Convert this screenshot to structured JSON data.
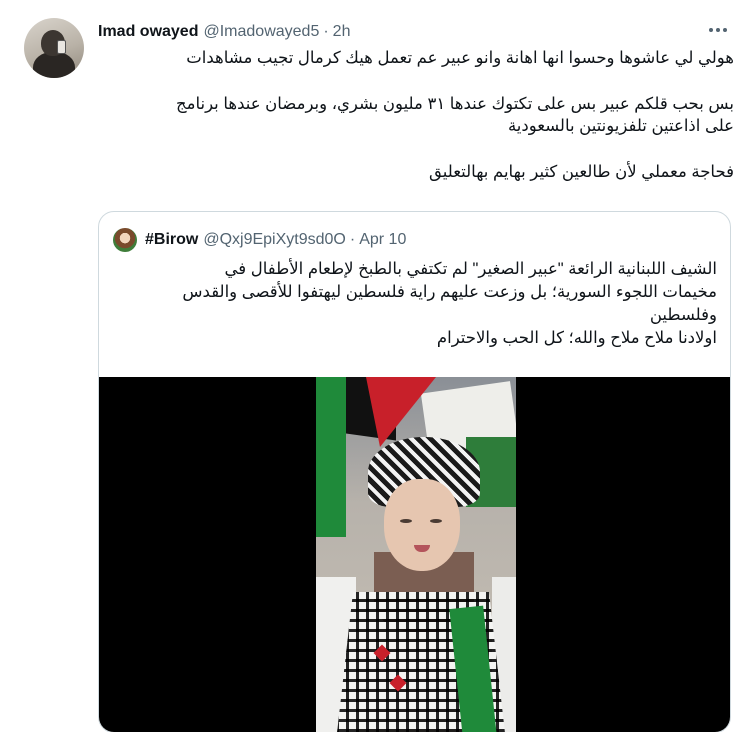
{
  "tweet": {
    "author_name": "Imad owayed",
    "author_handle": "@Imadowayed5",
    "separator": "·",
    "time": "2h",
    "text_lines": [
      "هولي لي عاشوها وحسوا انها اهانة وانو عبير عم تعمل هيك كرمال تجيب مشاهدات",
      "بس بحب قلكم عبير بس على تكتوك عندها ٣١ مليون بشري، وبرمضان عندها برنامج",
      "على اذاعتين تلفزيونتين بالسعودية",
      "فحاجة معملي لأن طالعين كثير بهايم بهالتعليق"
    ]
  },
  "quoted": {
    "author_name": "#Birow",
    "author_handle": "@Qxj9EpiXyt9sd0O",
    "separator": "·",
    "time": "Apr 10",
    "text_lines": [
      "الشيف اللبنانية الرائعة \"عبير الصغير\" لم تكتفي بالطبخ لإطعام الأطفال في",
      "مخيمات اللجوء السورية؛ بل وزعت عليهم راية فلسطين ليهتفوا للأقصى والقدس",
      "وفلسطين",
      "اولادنا ملاح ملاح والله؛ كل الحب والاحترام"
    ],
    "media": {
      "type": "video-thumbnail",
      "bg": "#000000"
    }
  },
  "colors": {
    "text": "#0f1419",
    "secondary": "#536471",
    "border": "#cfd9de"
  },
  "icons": {
    "more": "more-horizontal-icon"
  }
}
